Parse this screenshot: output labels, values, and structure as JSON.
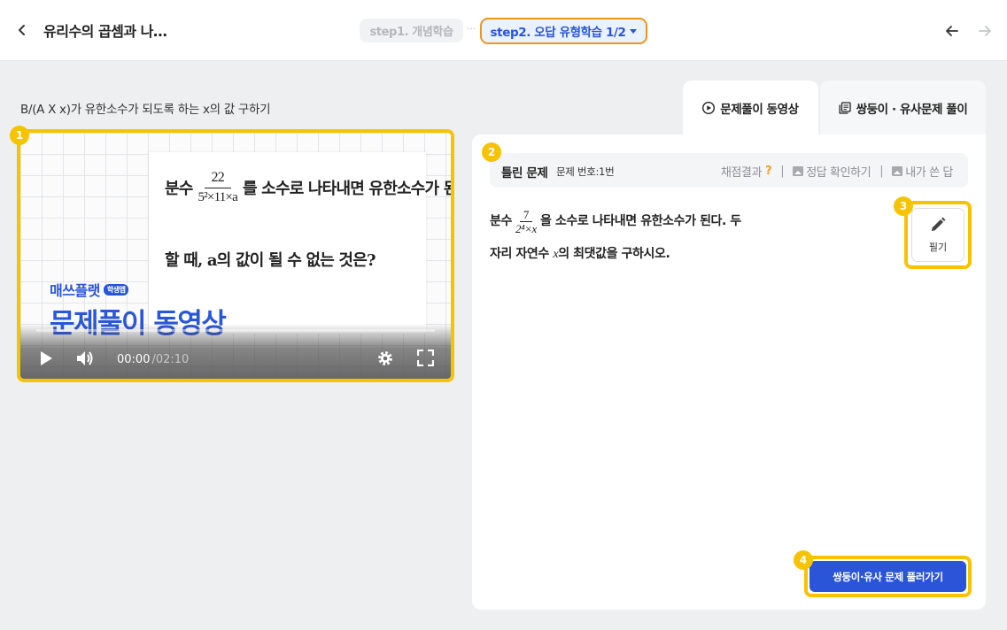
{
  "header": {
    "title": "유리수의 곱셈과 나…",
    "step1_label": "step1. 개념학습",
    "separator": "···",
    "step2_label": "step2. 오답 유형학습 1/2"
  },
  "problem_caption": "B/(A X x)가 유한소수가 되도록 하는 x의 값 구하기",
  "video": {
    "slide": {
      "line1_prefix": "분수",
      "frac_num": "22",
      "frac_den": "5²×11×a",
      "line1_suffix": "를 소수로 나타내면 유한소수가 된다고",
      "line2": "할 때, a의 값이 될 수 없는 것은?"
    },
    "brand": "매쓰플랫",
    "brand_badge": "학생앱",
    "big_title": "문제풀이 동영상",
    "current_time": "00:00",
    "duration": "02:10",
    "progress": 0
  },
  "tabs": {
    "active": "문제풀이 동영상",
    "inactive": "쌍둥이 · 유사문제 풀이"
  },
  "wrong_problem": {
    "title": "틀린 문제",
    "number": "문제 번호:1번",
    "grading": "채점결과",
    "grading_help": "?",
    "sep": "|",
    "check_answer": "정답 확인하기",
    "my_answer": "내가 쓴 답"
  },
  "question": {
    "prefix": "분수",
    "frac_num": "7",
    "frac_den": "2⁴×x",
    "line1_suffix": "을 소수로 나타내면 유한소수가 된다. 두",
    "line2_prefix": "자리 자연수",
    "line2_var": "x",
    "line2_suffix": "의 최댓값을 구하시오."
  },
  "memo_label": "필기",
  "cta_label": "쌍둥이·유사 문제 풀러가기",
  "markers": [
    "1",
    "2",
    "3",
    "4"
  ],
  "colors": {
    "accent_blue": "#2a55d9",
    "highlight_yellow": "#f7c300",
    "step_border_orange": "#f0941e"
  }
}
